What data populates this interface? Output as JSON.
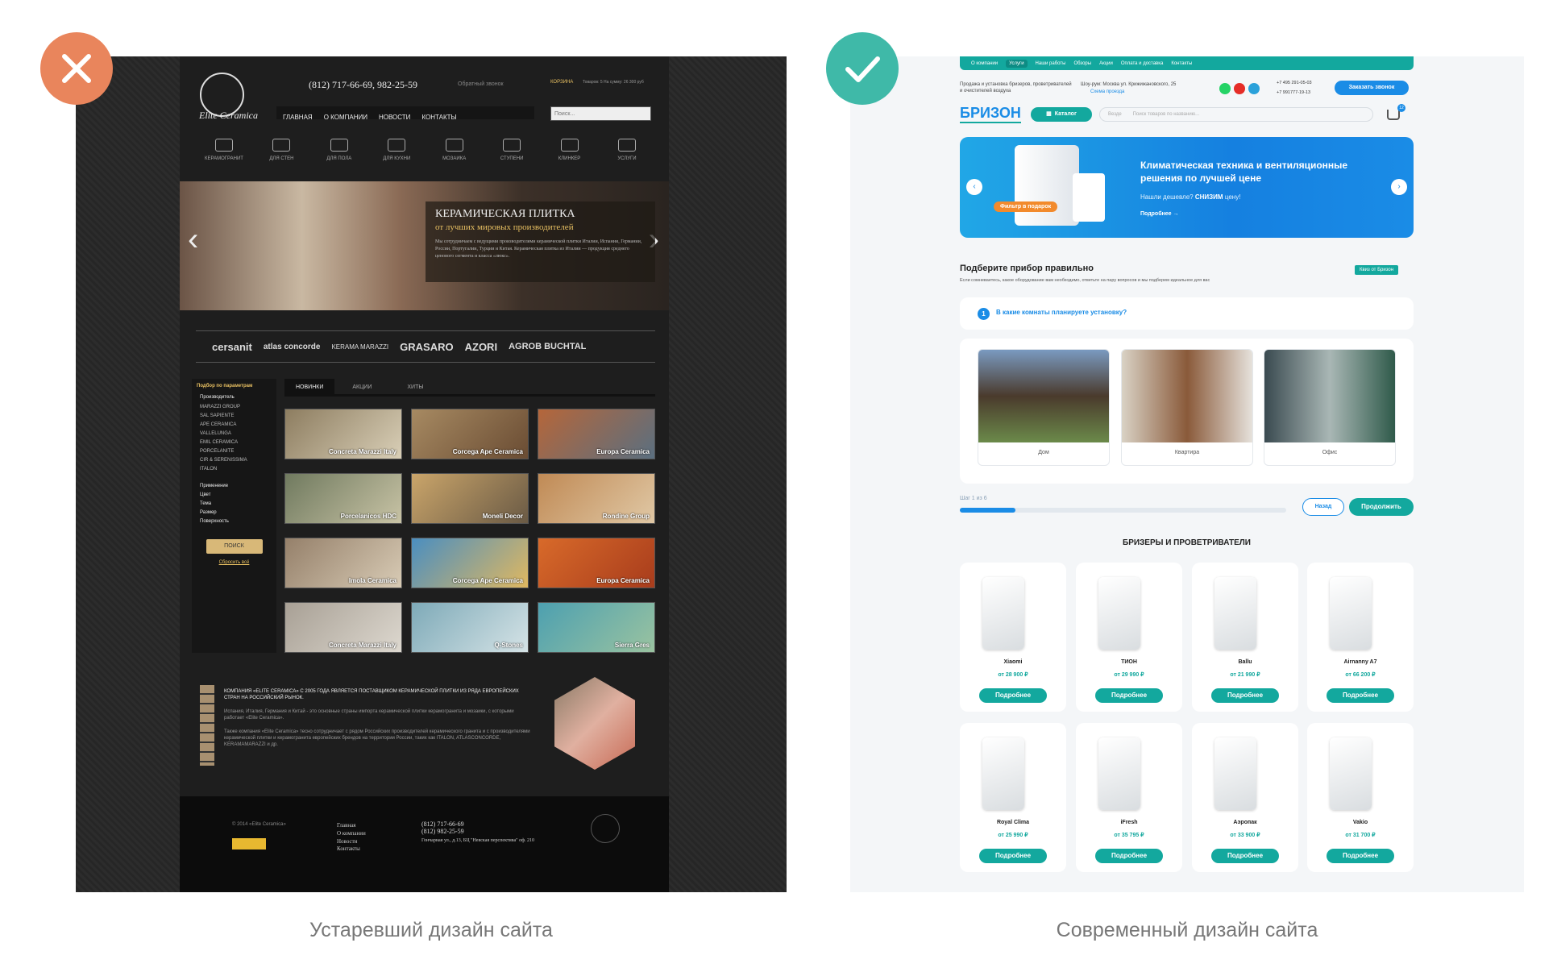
{
  "captions": {
    "bad": "Устаревший дизайн сайта",
    "good": "Современный дизайн сайта"
  },
  "colors": {
    "bad_badge": "#e9855c",
    "good_badge": "#3fb9a8",
    "teal": "#13a89e",
    "blue": "#1a8ce6"
  },
  "old_site": {
    "logo": "Elite Ceramica",
    "phones": "(812) 717-66-69,  982-25-59",
    "callback": "Обратный звонок",
    "cart": "КОРЗИНА",
    "cart_info": "Товаров: 5 На сумму: 26 300 руб",
    "search_placeholder": "Поиск...",
    "nav": [
      "ГЛАВНАЯ",
      "О КОМПАНИИ",
      "НОВОСТИ",
      "КОНТАКТЫ"
    ],
    "categories": [
      "КЕРАМОГРАНИТ",
      "ДЛЯ СТЕН",
      "ДЛЯ ПОЛА",
      "ДЛЯ КУХНИ",
      "МОЗАИКА",
      "СТУПЕНИ",
      "КЛИНКЕР",
      "УСЛУГИ"
    ],
    "banner_title": "КЕРАМИЧЕСКАЯ ПЛИТКА",
    "banner_subtitle": "от лучших мировых производителей",
    "banner_text": "Мы сотрудничаем с ведущими производителями керамической плитки Италии, Испании, Германии, России, Португалии, Турции и Китая. Керамическая плитка из Италии — продукция среднего ценового сегмента и класса «люкс».",
    "brands": [
      "cersanit",
      "atlas concorde",
      "KERAMA MARAZZI",
      "GRASARO",
      "AZORI",
      "AGROB BUCHTAL"
    ],
    "filter_title": "Подбор по параметрам",
    "filter_group": "Производитель",
    "makers": [
      "MARAZZI GROUP",
      "SAL SAPIENTE",
      "APE CERAMICA",
      "VALLELUNGA",
      "EMIL CERAMICA",
      "PORCELANITE",
      "CIR & SERENISSIMA",
      "ITALON"
    ],
    "filter_more": [
      "Применение",
      "Цвет",
      "Тема",
      "Размер",
      "Поверхность"
    ],
    "search_btn": "ПОИСК",
    "reset": "Сбросить всё",
    "tabs": [
      "НОВИНКИ",
      "АКЦИИ",
      "ХИТЫ"
    ],
    "tiles": [
      "Concreta Marazzi Italy",
      "Corcega Ape Ceramica",
      "Europa Ceramica",
      "Porcelanicos HDC",
      "Moneli Decor",
      "Rondine Group",
      "Imola Ceramica",
      "Corcega Ape Ceramica",
      "Europa Ceramica",
      "Concreta Marazzi Italy",
      "Q-Stones",
      "Sierra Gres"
    ],
    "about_title": "КОМПАНИЯ «ELITE CERAMICA» С 2005 ГОДА ЯВЛЯЕТСЯ ПОСТАВЩИКОМ КЕРАМИЧЕСКОЙ ПЛИТКИ ИЗ РЯДА ЕВРОПЕЙСКИХ СТРАН НА РОССИЙСКИЙ РЫНОК.",
    "about_p1": "Испания, Италия, Германия и Китай - это основные страны импорта керамической плитки керамогранита и мозаики, с которыми работает «Elite Ceramica».",
    "about_p2": "Также компания «Elite Ceramica» тесно сотрудничает с рядом Российских производителей керамического гранита и с производителями керамической плитки и керамогранита европейских брендов на территории России, таких как ITALON, ATLASCONCORDE, KERAMAMARAZZI и др.",
    "footer_copy": "© 2014 «Elite Ceramica»",
    "footer_links": [
      "Главная",
      "О компании",
      "Новости",
      "Контакты"
    ],
    "footer_phones": "(812) 717-66-69\n(812) 982-25-59",
    "footer_address": "Гончарная ул., д.13, БЦ \"Невская перспектива\" оф. 210"
  },
  "new_site": {
    "top_menu": [
      "О компании",
      "Услуги",
      "Наши работы",
      "Обзоры",
      "Акции",
      "Оплата и доставка",
      "Контакты"
    ],
    "tagline": "Продажа и установка бризеров, проветривателей и очистителей воздуха",
    "address": "Шоу-рум: Москва ул. Крижижановского, 25",
    "address_link": "Схема проезда",
    "phone1": "+7 495 291-05-03",
    "phone2": "+7 991777-19-13",
    "call_btn": "Заказать звонок",
    "logo": "БРИЗОН",
    "catalog_btn": "Каталог",
    "search_scope": "Везде",
    "search_placeholder": "Поиск товаров по названию...",
    "cart_count": "12",
    "hero_title": "Климатическая техника и вентиляционные решения по лучшей цене",
    "hero_sub_a": "Нашли дешевле?",
    "hero_sub_b": "СНИЗИМ",
    "hero_sub_c": "цену!",
    "hero_more": "Подробнее →",
    "hero_badge": "Фильтр в подарок",
    "quiz_title": "Подберите прибор правильно",
    "quiz_desc": "Если сомневаетесь, какое оборудование вам необходимо, ответьте на пару вопросов и мы подберем идеальное для вас",
    "quiz_tag": "Квиз от Бризон",
    "quiz_step_num": "1",
    "quiz_question": "В какие комнаты планируете установку?",
    "rooms": [
      "Дом",
      "Квартира",
      "Офис"
    ],
    "step": "Шаг 1 из 6",
    "step_progress": 0.17,
    "back_btn": "Назад",
    "next_btn": "Продолжить",
    "products_title": "БРИЗЕРЫ И ПРОВЕТРИВАТЕЛИ",
    "products": [
      {
        "name": "Xiaomi",
        "price": "от 28 900 ₽"
      },
      {
        "name": "ТИОН",
        "price": "от 29 990 ₽"
      },
      {
        "name": "Ballu",
        "price": "от 21 990 ₽"
      },
      {
        "name": "Airnanny A7",
        "price": "от 66 200 ₽"
      },
      {
        "name": "Royal Clima",
        "price": "от 25 990 ₽"
      },
      {
        "name": "iFresh",
        "price": "от 35 795 ₽"
      },
      {
        "name": "Аэропак",
        "price": "от 33 900 ₽"
      },
      {
        "name": "Vakio",
        "price": "от 31 700 ₽"
      }
    ],
    "more_label": "Подробнее"
  }
}
